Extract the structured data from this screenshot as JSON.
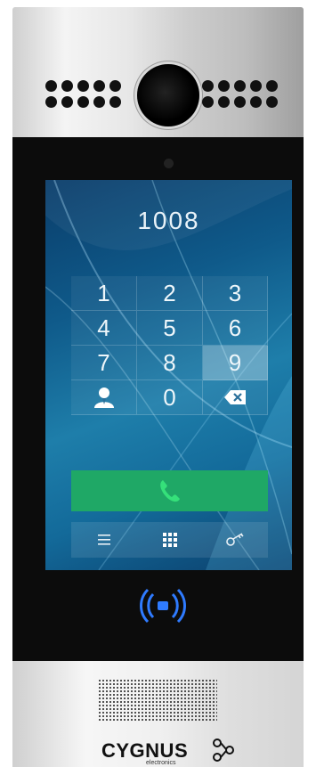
{
  "dial": {
    "number": "1008"
  },
  "keypad": {
    "keys": [
      "1",
      "2",
      "3",
      "4",
      "5",
      "6",
      "7",
      "8",
      "9",
      "contact",
      "0",
      "backspace"
    ],
    "selected": "9"
  },
  "toolbar": {
    "items": [
      "menu-icon",
      "grid-icon",
      "key-icon"
    ]
  },
  "brand": {
    "name": "CYGNUS",
    "sub": "electronics"
  },
  "colors": {
    "call_button": "#1fa866",
    "call_icon": "#35e07a",
    "nfc": "#2f7bff",
    "screen": "#0f5a8a"
  }
}
